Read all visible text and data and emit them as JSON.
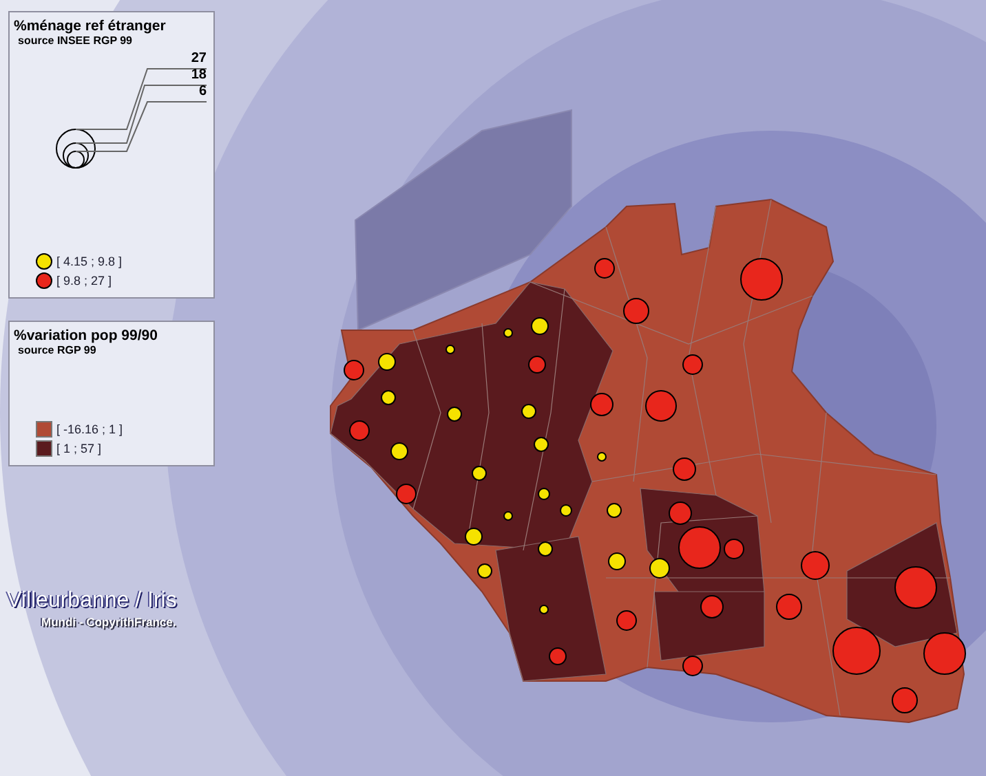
{
  "legends": [
    {
      "kind": "circles",
      "title": "%ménage ref étranger",
      "source": "source INSEE RGP 99",
      "size_labels": [
        "27",
        "18",
        "6"
      ],
      "classes": [
        {
          "label": "[ 4.15 ; 9.8 ]",
          "color": "#f5e200"
        },
        {
          "label": "[ 9.8 ; 27 ]",
          "color": "#e8261c"
        }
      ]
    },
    {
      "kind": "squares",
      "title": "%variation pop 99/90",
      "source": "source RGP 99",
      "classes": [
        {
          "label": "[ -16.16 ; 1 ]",
          "color": "#b04a35"
        },
        {
          "label": "[ 1 ; 57 ]",
          "color": "#5a1a1e"
        }
      ]
    }
  ],
  "map_title": "Villeurbanne / Iris",
  "copyright": "Mundi - CopyrithFrance."
}
